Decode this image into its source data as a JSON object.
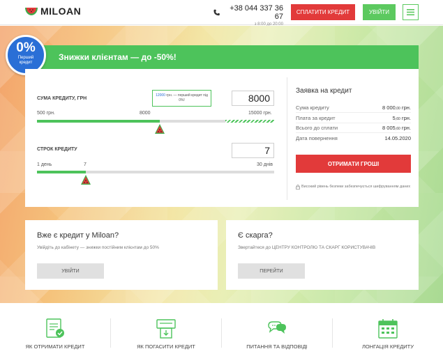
{
  "header": {
    "logo_text": "MILOAN",
    "phone": "+38 044 337 36 67",
    "hours": "з 8:00 до 20:00",
    "pay_button": "СПЛАТИТИ КРЕДИТ",
    "login_button": "УВІЙТИ",
    "menu_icon": "hamburger-icon"
  },
  "badge": {
    "percent": "0%",
    "caption": "Перший кредит"
  },
  "promo": {
    "text": "Знижки клієнтам — до -50%!"
  },
  "calculator": {
    "amount": {
      "label": "СУМА КРЕДИТУ, ГРН",
      "value": "8000",
      "min_label": "500 грн.",
      "current_label": "8000",
      "max_label": "15000 грн.",
      "min": 500,
      "max": 15000,
      "current": 8000,
      "free_limit": 12000,
      "tooltip_highlight": "12000",
      "tooltip_text": "грн. — перший кредит під 0%!"
    },
    "term": {
      "label": "СТРОК КРЕДИТУ",
      "value": "7",
      "min_label": "1 день",
      "current_label": "7",
      "max_label": "30 днів",
      "min": 1,
      "max": 30,
      "current": 7
    }
  },
  "summary": {
    "title": "Заявка на кредит",
    "rows": [
      {
        "label": "Сума кредиту",
        "int": "8 000",
        "dec": ",00",
        "unit": " грн."
      },
      {
        "label": "Плата за кредит",
        "int": "5",
        "dec": ",60",
        "unit": " грн."
      },
      {
        "label": "Всього до сплати",
        "int": "8 005",
        "dec": ",60",
        "unit": " грн."
      },
      {
        "label": "Дата повернення",
        "int": "14.05.2020",
        "dec": "",
        "unit": ""
      }
    ],
    "button": "ОТРИМАТИ ГРОШІ",
    "security_note": "Високий рівень безпеки забезпечується шифруванням даних"
  },
  "cards": [
    {
      "title": "Вже є кредит у Miloan?",
      "text": "Увійдіть до кабінету — знижки постійним клієнтам до 50%",
      "button": "УВІЙТИ"
    },
    {
      "title": "Є скарга?",
      "text": "Звертайтеся до ЦЕНТРУ КОНТРОЛЮ ТА СКАРГ КОРИСТУВАЧІВ",
      "button": "ПЕРЕЙТИ"
    }
  ],
  "features": [
    {
      "label": "ЯК ОТРИМАТИ КРЕДИТ",
      "icon": "document-check-icon"
    },
    {
      "label": "ЯК ПОГАСИТИ КРЕДИТ",
      "icon": "payment-terminal-icon"
    },
    {
      "label": "ПИТАННЯ ТА ВІДПОВІДІ",
      "icon": "chat-bubbles-icon"
    },
    {
      "label": "ЛОНГАЦІЯ КРЕДИТУ",
      "icon": "calendar-icon"
    }
  ],
  "colors": {
    "green": "#4dc35b",
    "red": "#e23a3a",
    "blue": "#2a6fd6"
  }
}
